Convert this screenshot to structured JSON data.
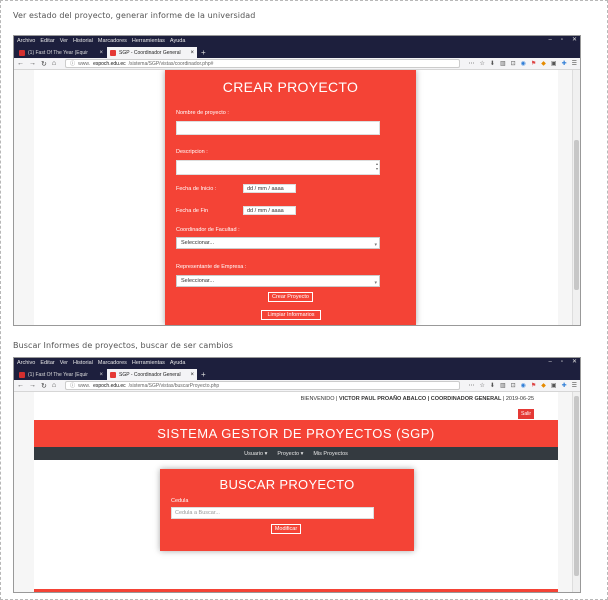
{
  "captions": {
    "top": "Ver estado del proyecto, generar informe de la universidad",
    "middle": "Buscar Informes de proyectos, buscar de ser cambios"
  },
  "browser": {
    "menu": [
      "Archivo",
      "Editar",
      "Ver",
      "Historial",
      "Marcadores",
      "Herramientas",
      "Ayuda"
    ],
    "window_controls": [
      "–",
      "▫",
      "✕"
    ],
    "tabs": [
      {
        "label": "(1) Fast Of The Year (Equir",
        "favicon_color": "#d32f2f",
        "active": false
      },
      {
        "label": "SGP - Coordinador General",
        "favicon_color": "#e53935",
        "active": true
      }
    ],
    "new_tab": "+",
    "nav_glyphs": {
      "back": "←",
      "forward": "→",
      "reload": "↻",
      "home": "⌂"
    },
    "toolbar_icons": [
      "⋯",
      "☆",
      "⬇",
      "▥",
      "⊡",
      "◉",
      "⚑",
      "◆",
      "▣",
      "✚",
      "☰"
    ]
  },
  "shot1": {
    "url_prefix": "www.",
    "url_domain": "espoch.edu.ec",
    "url_path": "/sistema/SGP/vistas/coordinador.php#",
    "form_title": "CREAR PROYECTO",
    "labels": {
      "nombre": "Nombre de proyecto :",
      "descripcion": "Descripcion :",
      "fecha_inicio": "Fecha de Inicio :",
      "fecha_fin": "Fecha de Fin",
      "coordinador": "Coordinador de Facultad :",
      "representante": "Representante de Empresa :"
    },
    "date_placeholder": "dd / mm / aaaa",
    "select_default": "Seleccionar...",
    "buttons": {
      "crear": "Crear Proyecto",
      "limpiar": "Limpiar Informarios"
    }
  },
  "shot2": {
    "url_prefix": "www.",
    "url_domain": "espoch.edu.ec",
    "url_path": "/sistema/SGP/vistas/buscarProyecto.php",
    "welcome_prefix": "BIENVENIDO |",
    "welcome_user": "VICTOR PAUL PROAÑO ABALCO | COORDINADOR GENERAL",
    "welcome_date": "| 2019-06-25",
    "logout": "Salir",
    "app_title": "SISTEMA GESTOR DE PROYECTOS (SGP)",
    "nav": [
      "Usuario ▾",
      "Proyecto ▾",
      "Mis Proyectos"
    ],
    "search_title": "BUSCAR PROYECTO",
    "search_label": "Cedula",
    "search_placeholder": "Cedula a Buscar...",
    "search_button": "Modificar"
  },
  "colors": {
    "accent": "#f44336",
    "browser_chrome": "#1d1f3d",
    "nav_dark": "#343a40"
  }
}
